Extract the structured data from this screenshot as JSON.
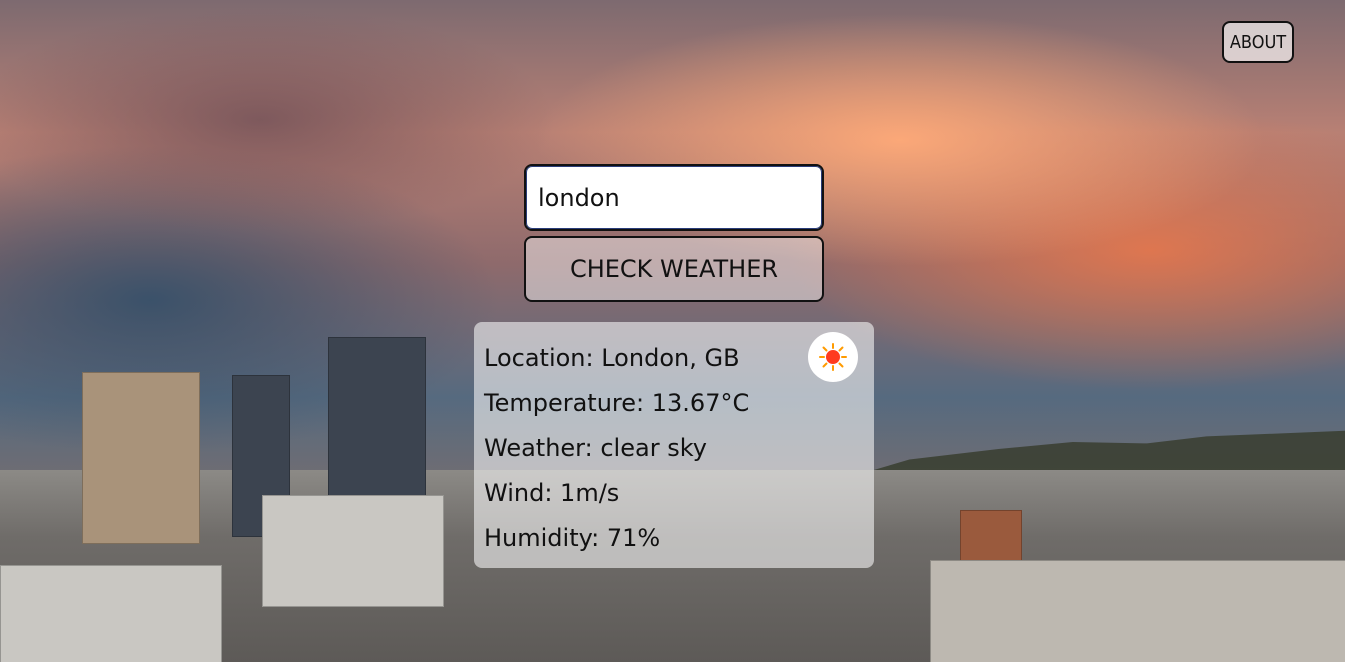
{
  "header": {
    "about_label": "ABOUT"
  },
  "search": {
    "value": "london",
    "button_label": "CHECK WEATHER"
  },
  "weather": {
    "location_label": "Location:",
    "location_value": "London, GB",
    "temperature_label": "Temperature:",
    "temperature_value": "13.67°C",
    "condition_label": "Weather:",
    "condition_value": "clear sky",
    "wind_label": "Wind:",
    "wind_value": "1m/s",
    "humidity_label": "Humidity:",
    "humidity_value": "71%",
    "icon": "sun-icon"
  },
  "colors": {
    "accent": "#111111",
    "card_bg": "#f5f5f5",
    "sun": "#ff3b1f",
    "sun_rays": "#ff9b00"
  }
}
